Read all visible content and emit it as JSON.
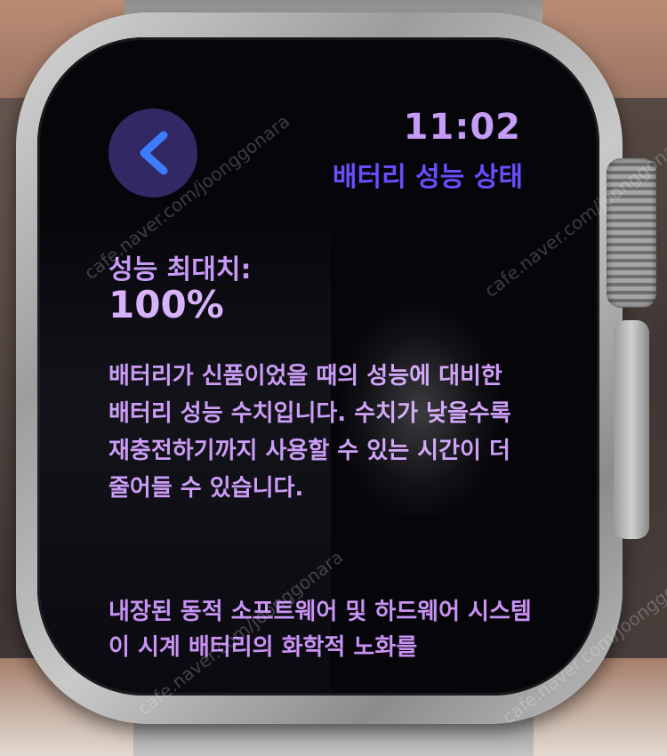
{
  "status": {
    "time": "11:02"
  },
  "header": {
    "title": "배터리 성능 상태"
  },
  "metric": {
    "label": "성능 최대치:",
    "value": "100%"
  },
  "description": "배터리가 신품이었을 때의 성능에 대비한 배터리 성능 수치입니다. 수치가 낮을수록 재충전하기까지 사용할 수 있는 시간이 더 줄어들 수 있습니다.",
  "footer": "내장된 동적 소프트웨어 및 하드웨어 시스템이 시계 배터리의 화학적 노화를",
  "icons": {
    "back": "chevron-left-icon"
  },
  "colors": {
    "accent": "#6d4cff",
    "text": "#c89af8",
    "back_button": "#5846af"
  },
  "watermark": {
    "text": "cafe.naver.com/joonggonara"
  }
}
